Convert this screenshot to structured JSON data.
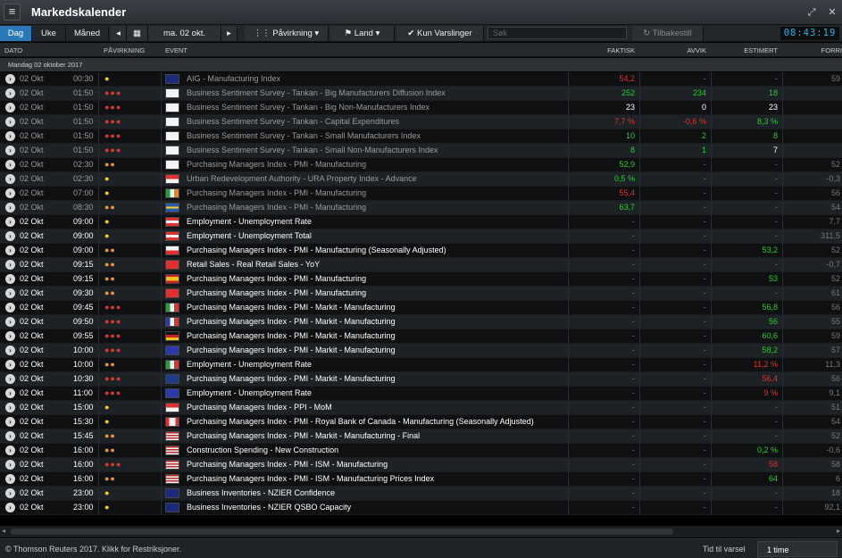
{
  "titlebar": {
    "menu_icon": "hamburger-icon",
    "title": "Markedskalender"
  },
  "toolbar": {
    "tabs": [
      "Dag",
      "Uke",
      "Måned"
    ],
    "date": "ma. 02 okt.",
    "impact_label": "Påvirkning",
    "country_label": "Land",
    "alerts_label": "Kun Varslinger",
    "search_placeholder": "Søk",
    "reset_label": "Tilbakestill",
    "clock": "08:43:19"
  },
  "columns": {
    "date": "DATO",
    "impact": "PÅVIRKNING",
    "event": "EVENT",
    "actual": "FAKTISK",
    "deviation": "AVVIK",
    "estimated": "ESTIMERT",
    "previous": "FORRI"
  },
  "group_label": "Mandag 02 oktober 2017",
  "colors": {
    "accent": "#2a78b8",
    "clock": "#22b6e6",
    "positive": "#21d021",
    "negative": "#e03030"
  },
  "rows": [
    {
      "date": "02 Okt",
      "time": "00:30",
      "impact": 1,
      "flag": "AU",
      "event": "AIG - Manufacturing Index",
      "actual": "54,2",
      "actual_c": "red",
      "dev": "-",
      "est": "-",
      "prev": "59",
      "dim": true
    },
    {
      "date": "02 Okt",
      "time": "01:50",
      "impact": 3,
      "flag": "JP",
      "event": "Business Sentiment Survey - Tankan - Big Manufacturers Diffusion Index",
      "actual": "252",
      "actual_c": "green",
      "dev": "234",
      "dev_c": "green",
      "est": "18",
      "est_c": "green",
      "prev": "",
      "dim": true
    },
    {
      "date": "02 Okt",
      "time": "01:50",
      "impact": 3,
      "flag": "JP",
      "event": "Business Sentiment Survey - Tankan - Big Non-Manufacturers Index",
      "actual": "23",
      "actual_c": "white",
      "dev": "0",
      "dev_c": "white",
      "est": "23",
      "est_c": "white",
      "prev": "",
      "dim": true
    },
    {
      "date": "02 Okt",
      "time": "01:50",
      "impact": 3,
      "flag": "JP",
      "event": "Business Sentiment Survey - Tankan - Capital Expenditures",
      "actual": "7,7 %",
      "actual_c": "red",
      "dev": "-0,6 %",
      "dev_c": "red",
      "est": "8,3 %",
      "est_c": "green",
      "prev": "",
      "dim": true
    },
    {
      "date": "02 Okt",
      "time": "01:50",
      "impact": 3,
      "flag": "JP",
      "event": "Business Sentiment Survey - Tankan - Small Manufacturers Index",
      "actual": "10",
      "actual_c": "green",
      "dev": "2",
      "dev_c": "green",
      "est": "8",
      "est_c": "green",
      "prev": "",
      "dim": true
    },
    {
      "date": "02 Okt",
      "time": "01:50",
      "impact": 3,
      "flag": "JP",
      "event": "Business Sentiment Survey - Tankan - Small Non-Manufacturers Index",
      "actual": "8",
      "actual_c": "green",
      "dev": "1",
      "dev_c": "green",
      "est": "7",
      "est_c": "white",
      "prev": "",
      "dim": true
    },
    {
      "date": "02 Okt",
      "time": "02:30",
      "impact": 2,
      "flag": "JP",
      "event": "Purchasing Managers Index - PMI - Manufacturing",
      "actual": "52,9",
      "actual_c": "green",
      "dev": "-",
      "est": "-",
      "prev": "52",
      "dim": true
    },
    {
      "date": "02 Okt",
      "time": "02:30",
      "impact": 1,
      "flag": "SG",
      "event": "Urban Redevelopment Authority - URA Property Index - Advance",
      "actual": "0,5 %",
      "actual_c": "green",
      "dev": "-",
      "est": "-",
      "prev": "-0,3",
      "dim": true
    },
    {
      "date": "02 Okt",
      "time": "07:00",
      "impact": 1,
      "flag": "IE",
      "event": "Purchasing Managers Index - PMI - Manufacturing",
      "actual": "55,4",
      "actual_c": "red",
      "dev": "-",
      "est": "-",
      "prev": "56",
      "dim": true
    },
    {
      "date": "02 Okt",
      "time": "08:30",
      "impact": 2,
      "flag": "SE",
      "event": "Purchasing Managers Index - PMI - Manufacturing",
      "actual": "63,7",
      "actual_c": "green",
      "dev": "-",
      "est": "-",
      "prev": "54",
      "dim": true
    },
    {
      "date": "02 Okt",
      "time": "09:00",
      "impact": 1,
      "flag": "AT",
      "event": "Employment - Unemployment Rate",
      "actual": "-",
      "dev": "-",
      "est": "-",
      "prev": "7,7"
    },
    {
      "date": "02 Okt",
      "time": "09:00",
      "impact": 1,
      "flag": "AT",
      "event": "Employment - Unemployment Total",
      "actual": "-",
      "dev": "-",
      "est": "-",
      "prev": "311,5"
    },
    {
      "date": "02 Okt",
      "time": "09:00",
      "impact": 2,
      "flag": "PL",
      "event": "Purchasing Managers Index - PMI - Manufacturing (Seasonally Adjusted)",
      "actual": "-",
      "dev": "-",
      "est": "53,2",
      "est_c": "green",
      "prev": "52"
    },
    {
      "date": "02 Okt",
      "time": "09:15",
      "impact": 2,
      "flag": "CH",
      "event": "Retail Sales - Real Retail Sales - YoY",
      "actual": "-",
      "dev": "-",
      "est": "-",
      "prev": "-0,7"
    },
    {
      "date": "02 Okt",
      "time": "09:15",
      "impact": 2,
      "flag": "ES",
      "event": "Purchasing Managers Index - PMI - Manufacturing",
      "actual": "-",
      "dev": "-",
      "est": "53",
      "est_c": "green",
      "prev": "52"
    },
    {
      "date": "02 Okt",
      "time": "09:30",
      "impact": 2,
      "flag": "CH",
      "event": "Purchasing Managers Index - PMI - Manufacturing",
      "actual": "-",
      "dev": "-",
      "est": "-",
      "prev": "61"
    },
    {
      "date": "02 Okt",
      "time": "09:45",
      "impact": 3,
      "flag": "IT",
      "event": "Purchasing Managers Index - PMI - Markit - Manufacturing",
      "actual": "-",
      "dev": "-",
      "est": "56,8",
      "est_c": "green",
      "prev": "56"
    },
    {
      "date": "02 Okt",
      "time": "09:50",
      "impact": 3,
      "flag": "FR",
      "event": "Purchasing Managers Index - PMI - Markit - Manufacturing",
      "actual": "-",
      "dev": "-",
      "est": "56",
      "est_c": "green",
      "prev": "55"
    },
    {
      "date": "02 Okt",
      "time": "09:55",
      "impact": 3,
      "flag": "DE",
      "event": "Purchasing Managers Index - PMI - Markit - Manufacturing",
      "actual": "-",
      "dev": "-",
      "est": "60,6",
      "est_c": "green",
      "prev": "59"
    },
    {
      "date": "02 Okt",
      "time": "10:00",
      "impact": 3,
      "flag": "EU",
      "event": "Purchasing Managers Index - PMI - Markit - Manufacturing",
      "actual": "-",
      "dev": "-",
      "est": "58,2",
      "est_c": "green",
      "prev": "57"
    },
    {
      "date": "02 Okt",
      "time": "10:00",
      "impact": 2,
      "flag": "IT",
      "event": "Employment - Unemployment Rate",
      "actual": "-",
      "dev": "-",
      "est": "11,2 %",
      "est_c": "red",
      "prev": "11,3"
    },
    {
      "date": "02 Okt",
      "time": "10:30",
      "impact": 3,
      "flag": "GB",
      "event": "Purchasing Managers Index - PMI - Markit - Manufacturing",
      "actual": "-",
      "dev": "-",
      "est": "56,4",
      "est_c": "red",
      "prev": "56"
    },
    {
      "date": "02 Okt",
      "time": "11:00",
      "impact": 3,
      "flag": "EU",
      "event": "Employment - Unemployment Rate",
      "actual": "-",
      "dev": "-",
      "est": "9 %",
      "est_c": "red",
      "prev": "9,1"
    },
    {
      "date": "02 Okt",
      "time": "15:00",
      "impact": 1,
      "flag": "SG",
      "event": "Purchasing Managers Index - PPI - MoM",
      "actual": "-",
      "dev": "-",
      "est": "-",
      "prev": "51"
    },
    {
      "date": "02 Okt",
      "time": "15:30",
      "impact": 1,
      "flag": "CA",
      "event": "Purchasing Managers Index - PMI - Royal Bank of Canada - Manufacturing (Seasonally Adjusted)",
      "actual": "-",
      "dev": "-",
      "est": "-",
      "prev": "54"
    },
    {
      "date": "02 Okt",
      "time": "15:45",
      "impact": 2,
      "flag": "US",
      "event": "Purchasing Managers Index - PMI - Markit - Manufacturing - Final",
      "actual": "-",
      "dev": "-",
      "est": "-",
      "prev": "52"
    },
    {
      "date": "02 Okt",
      "time": "16:00",
      "impact": 2,
      "flag": "US",
      "event": "Construction Spending - New Construction",
      "actual": "-",
      "dev": "-",
      "est": "0,2 %",
      "est_c": "green",
      "prev": "-0,6"
    },
    {
      "date": "02 Okt",
      "time": "16:00",
      "impact": 3,
      "flag": "US",
      "event": "Purchasing Managers Index - PMI - ISM - Manufacturing",
      "actual": "-",
      "dev": "-",
      "est": "58",
      "est_c": "red",
      "prev": "58"
    },
    {
      "date": "02 Okt",
      "time": "16:00",
      "impact": 2,
      "flag": "US",
      "event": "Purchasing Managers Index - PMI - ISM - Manufacturing Prices Index",
      "actual": "-",
      "dev": "-",
      "est": "64",
      "est_c": "green",
      "prev": "6"
    },
    {
      "date": "02 Okt",
      "time": "23:00",
      "impact": 1,
      "flag": "NZ",
      "event": "Business Inventories - NZIER Confidence",
      "actual": "-",
      "dev": "-",
      "est": "-",
      "prev": "18"
    },
    {
      "date": "02 Okt",
      "time": "23:00",
      "impact": 1,
      "flag": "NZ",
      "event": "Business Inventories - NZIER QSBO Capacity",
      "actual": "-",
      "dev": "-",
      "est": "-",
      "prev": "92,1"
    }
  ],
  "footer": {
    "copyright": "© Thomson Reuters 2017. Klikk for Restriksjoner.",
    "alert_label": "Tid til varsel",
    "alert_value": "1 time"
  }
}
